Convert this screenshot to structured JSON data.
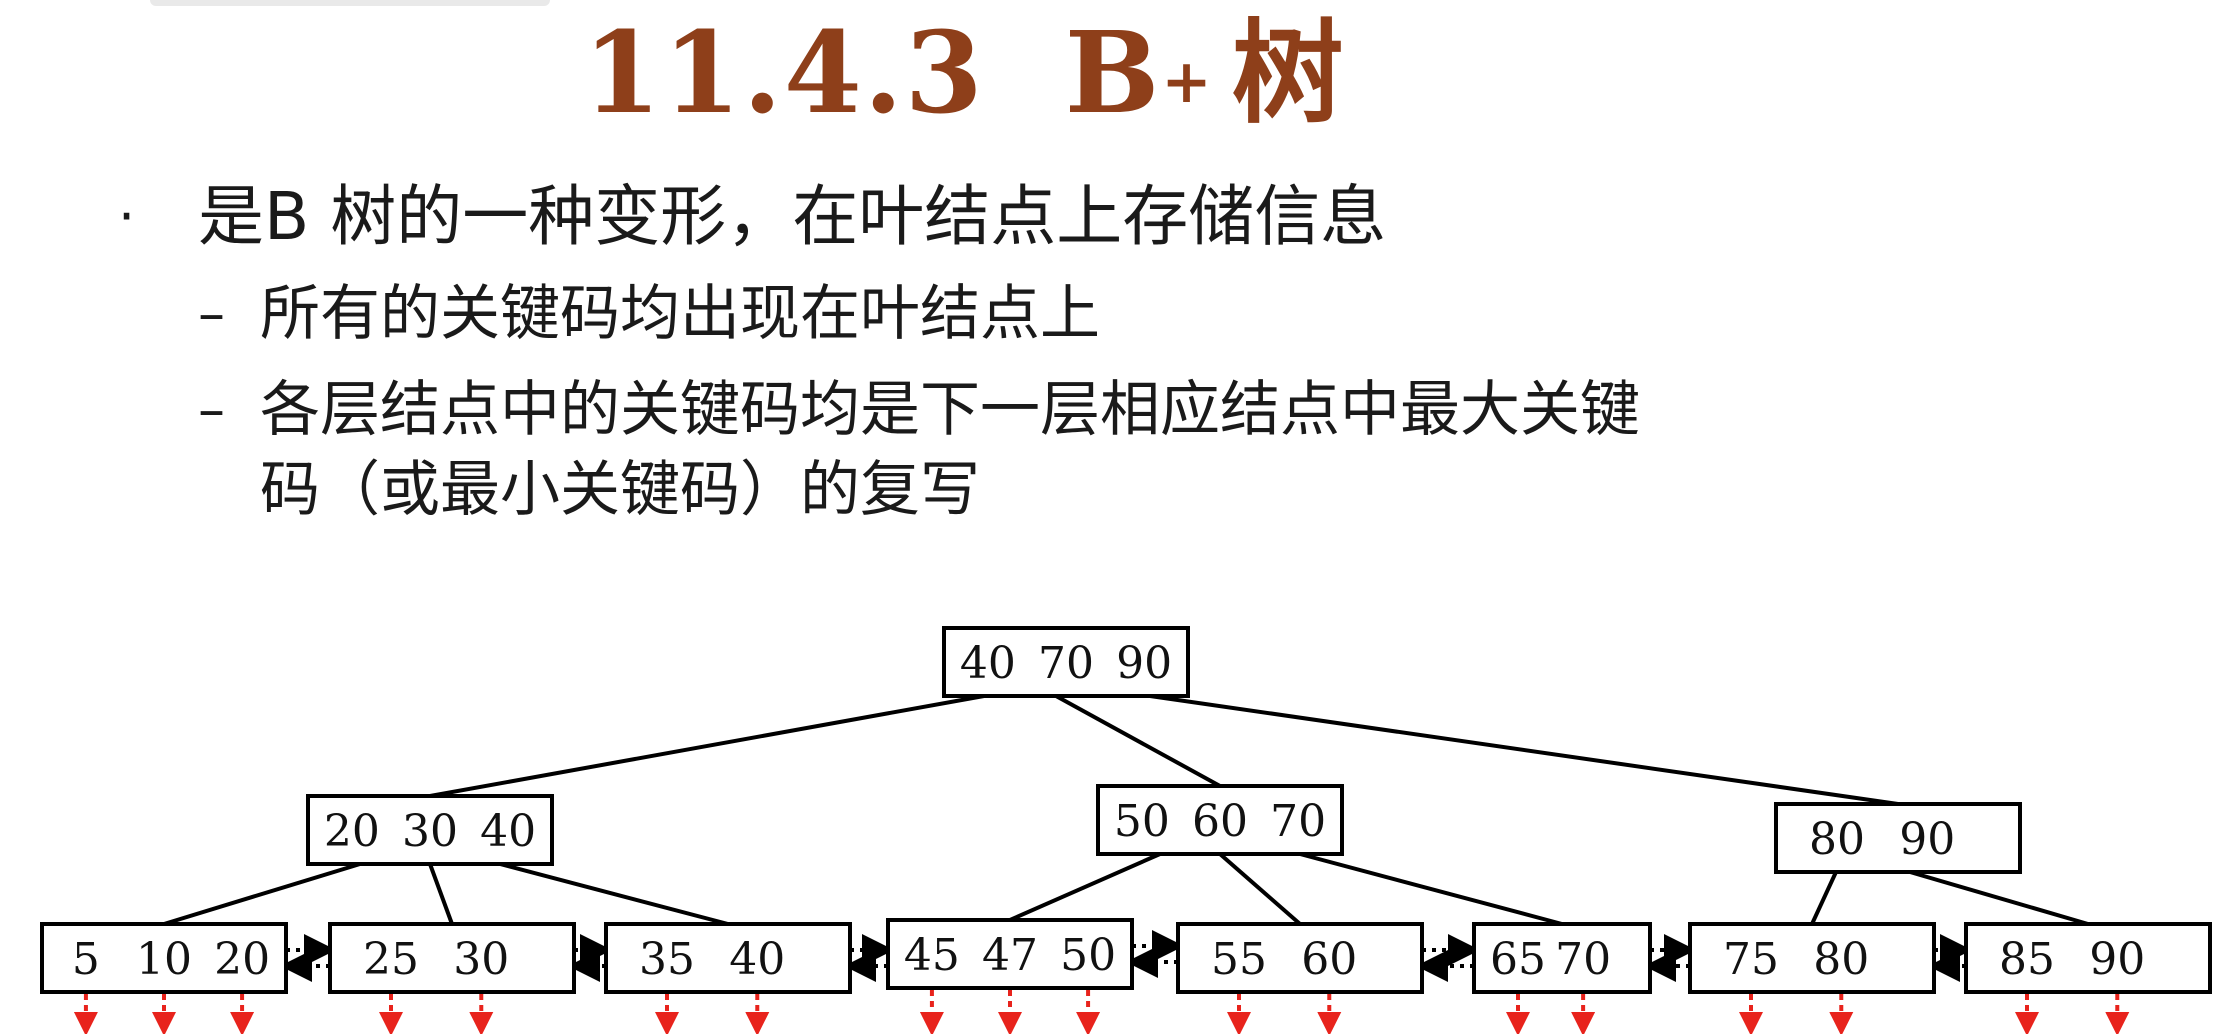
{
  "title": {
    "number": "11.4.3",
    "letter": "B",
    "superscript": "+",
    "word": "树"
  },
  "bullets": {
    "main_marker": "·",
    "main": "是B 树的一种变形，在叶结点上存储信息",
    "sub_marker": "–",
    "sub": [
      "所有的关键码均出现在叶结点上",
      "各层结点中的关键码均是下一层相应结点中最大关键",
      "码（或最小关键码）的复写"
    ]
  },
  "tree": {
    "root": {
      "keys": [
        "40",
        "70",
        "90"
      ]
    },
    "internal": [
      {
        "keys": [
          "20",
          "30",
          "40"
        ]
      },
      {
        "keys": [
          "50",
          "60",
          "70"
        ]
      },
      {
        "keys": [
          "80",
          "90"
        ]
      }
    ],
    "leaves": [
      {
        "keys": [
          "5",
          "10",
          "20"
        ]
      },
      {
        "keys": [
          "25",
          "30"
        ]
      },
      {
        "keys": [
          "35",
          "40"
        ]
      },
      {
        "keys": [
          "45",
          "47",
          "50"
        ]
      },
      {
        "keys": [
          "55",
          "60"
        ]
      },
      {
        "keys": [
          "65",
          "70"
        ]
      },
      {
        "keys": [
          "75",
          "80"
        ]
      },
      {
        "keys": [
          "85",
          "90"
        ]
      }
    ],
    "colors": {
      "line": "#000000",
      "record_arrow": "#e8231c",
      "node_fill": "#ffffff"
    }
  }
}
